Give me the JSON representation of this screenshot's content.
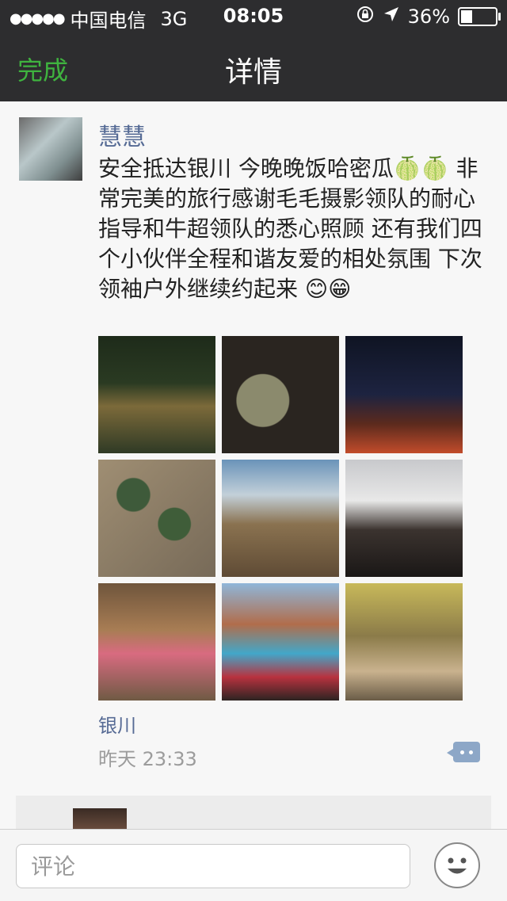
{
  "status_bar": {
    "carrier": "中国电信",
    "network": "3G",
    "time": "08:05",
    "battery": "36%"
  },
  "nav": {
    "done_label": "完成",
    "title": "详情"
  },
  "post": {
    "author": "慧慧",
    "text": "安全抵达银川 今晚晚饭哈密瓜🍈🍈 非常完美的旅行感谢毛毛摄影领队的耐心指导和牛超领队的悉心照顾 还有我们四个小伙伴全程和谐友爱的相处氛围 下次领袖户外继续约起来 😊😁",
    "location": "银川",
    "time": "昨天 23:33"
  },
  "comment_bar": {
    "placeholder": "评论"
  },
  "colors": {
    "nav_bg": "#2d2d2f",
    "accent_green": "#3fb33f",
    "name_blue": "#566b95"
  }
}
